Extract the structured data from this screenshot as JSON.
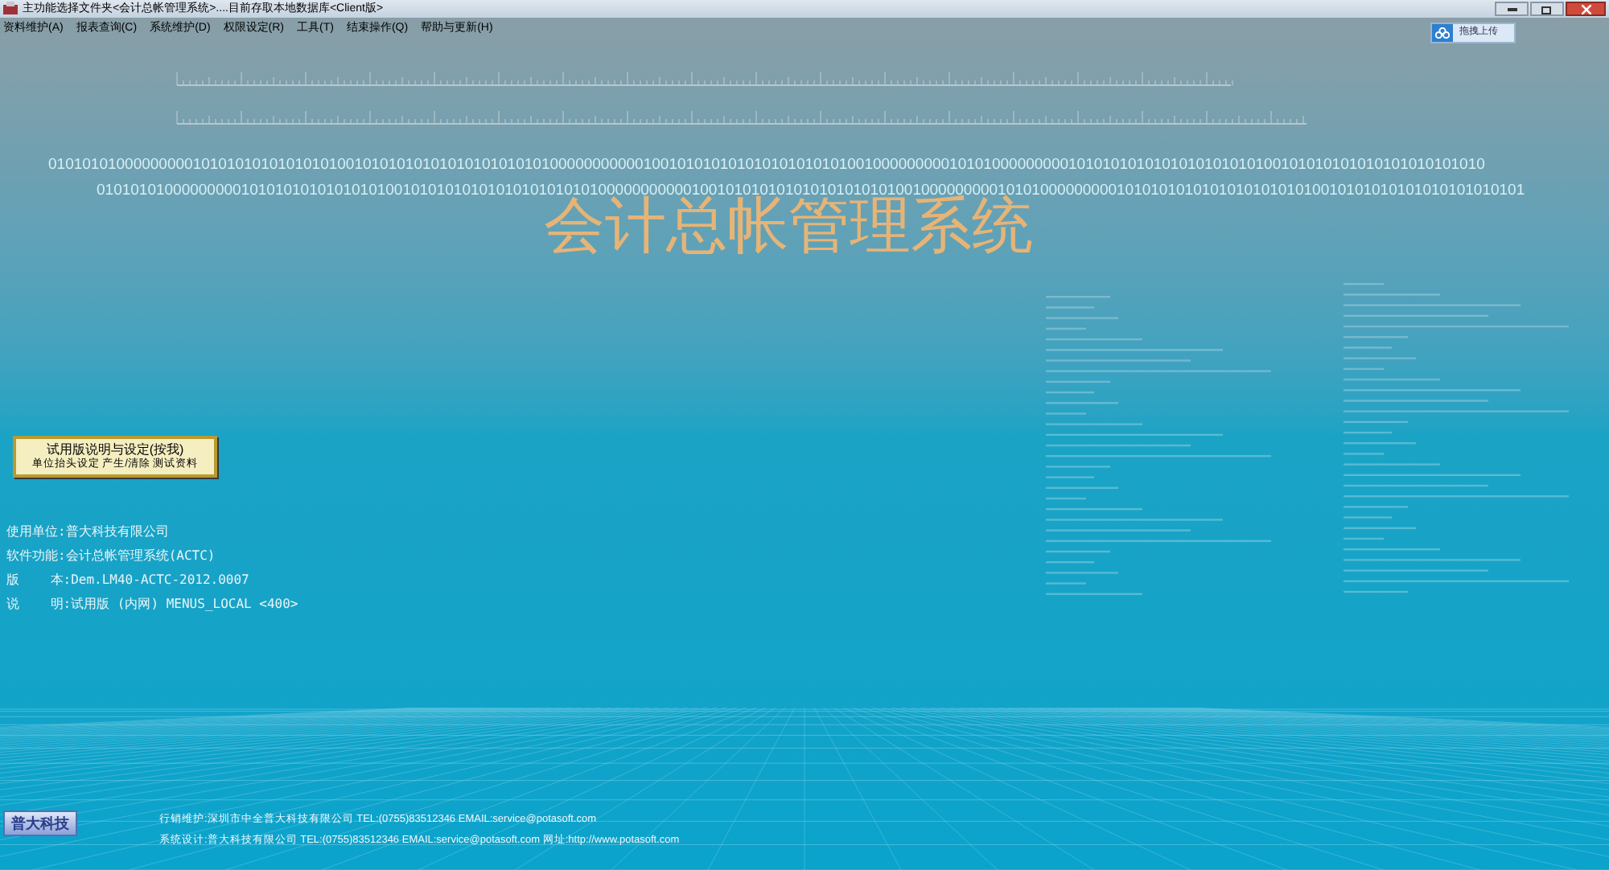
{
  "window": {
    "title": "主功能选择文件夹<会计总帐管理系统>....目前存取本地数据库<Client版>"
  },
  "menu": [
    "资料维护(A)",
    "报表查询(C)",
    "系统维护(D)",
    "权限设定(R)",
    "工具(T)",
    "结束操作(Q)",
    "帮助与更新(H)"
  ],
  "upload_button": {
    "label": "拖拽上传"
  },
  "background": {
    "binary_lines": [
      "0101010100000000010101010101010101001010101010101010101010100000000000100101010101010101010101001000000000101010000000001010101010101010101010100101010101010101010101010",
      "010101010000000001010101010101010100101010101010101010101010000000000010010101010101010101010100100000000010101000000000101010101010101010101010010101010101010101010101"
    ]
  },
  "main_title": "会计总帐管理系统",
  "trial_button": {
    "title": "试用版说明与设定(按我)",
    "subtitle": "单位抬头设定 产生/清除 测试资料"
  },
  "info": [
    {
      "label": "使用单位:",
      "value": "普大科技有限公司"
    },
    {
      "label": "软件功能:",
      "value": "会计总帐管理系统(ACTC)"
    },
    {
      "label": "版    本:",
      "value": "Dem.LM40-ACTC-2012.0007"
    },
    {
      "label": "说    明:",
      "value": "试用版 (内网) MENUS_LOCAL <400>"
    }
  ],
  "footer": {
    "logo": "普大科技",
    "lines": [
      "行销维护:深圳市中全普大科技有限公司 TEL:(0755)83512346 EMAIL:service@potasoft.com",
      "系统设计:普大科技有限公司 TEL:(0755)83512346  EMAIL:service@potasoft.com 网址:http://www.potasoft.com"
    ]
  }
}
